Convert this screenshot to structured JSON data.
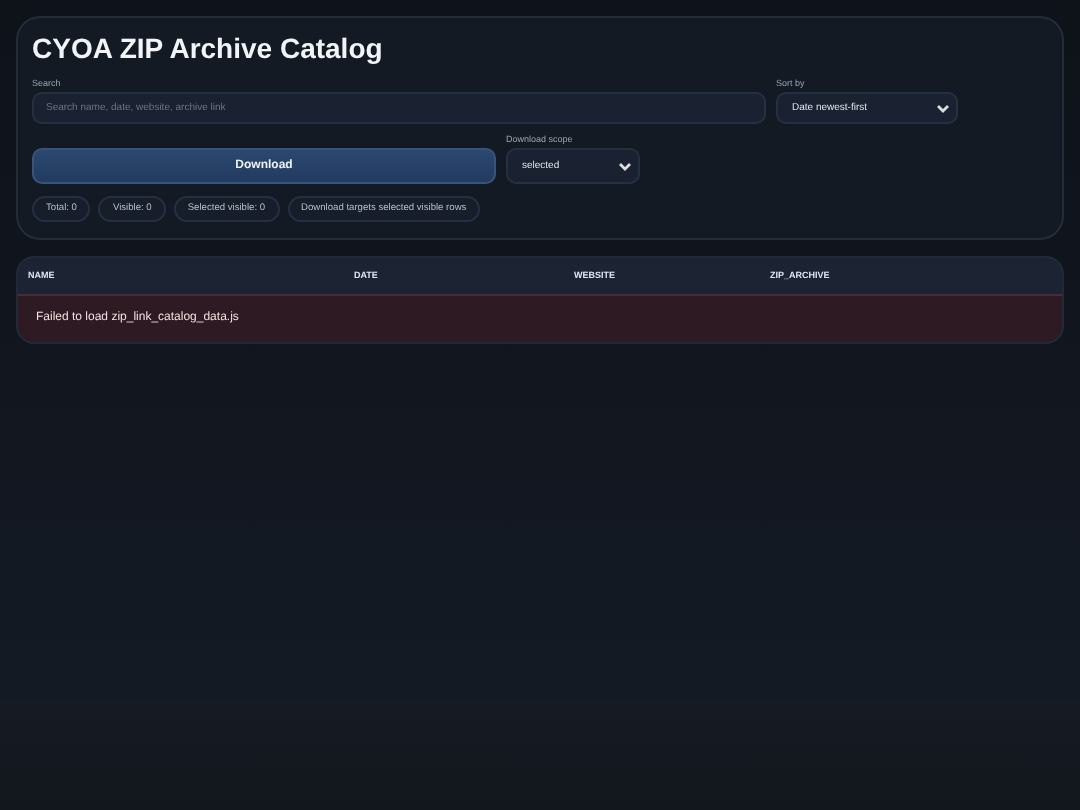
{
  "title": "CYOA ZIP Archive Catalog",
  "search": {
    "label": "Search",
    "placeholder": "Search name, date, website, archive link"
  },
  "sort": {
    "label": "Sort by",
    "value": "Date newest-first"
  },
  "download_button": "Download",
  "scope": {
    "label": "Download scope",
    "value": "selected"
  },
  "stats": [
    "Total: 0",
    "Visible: 0",
    "Selected visible: 0",
    "Download targets selected visible rows"
  ],
  "table": {
    "columns": [
      "NAME",
      "DATE",
      "WEBSITE",
      "ZIP_ARCHIVE"
    ],
    "error": "Failed to load zip_link_catalog_data.js"
  }
}
